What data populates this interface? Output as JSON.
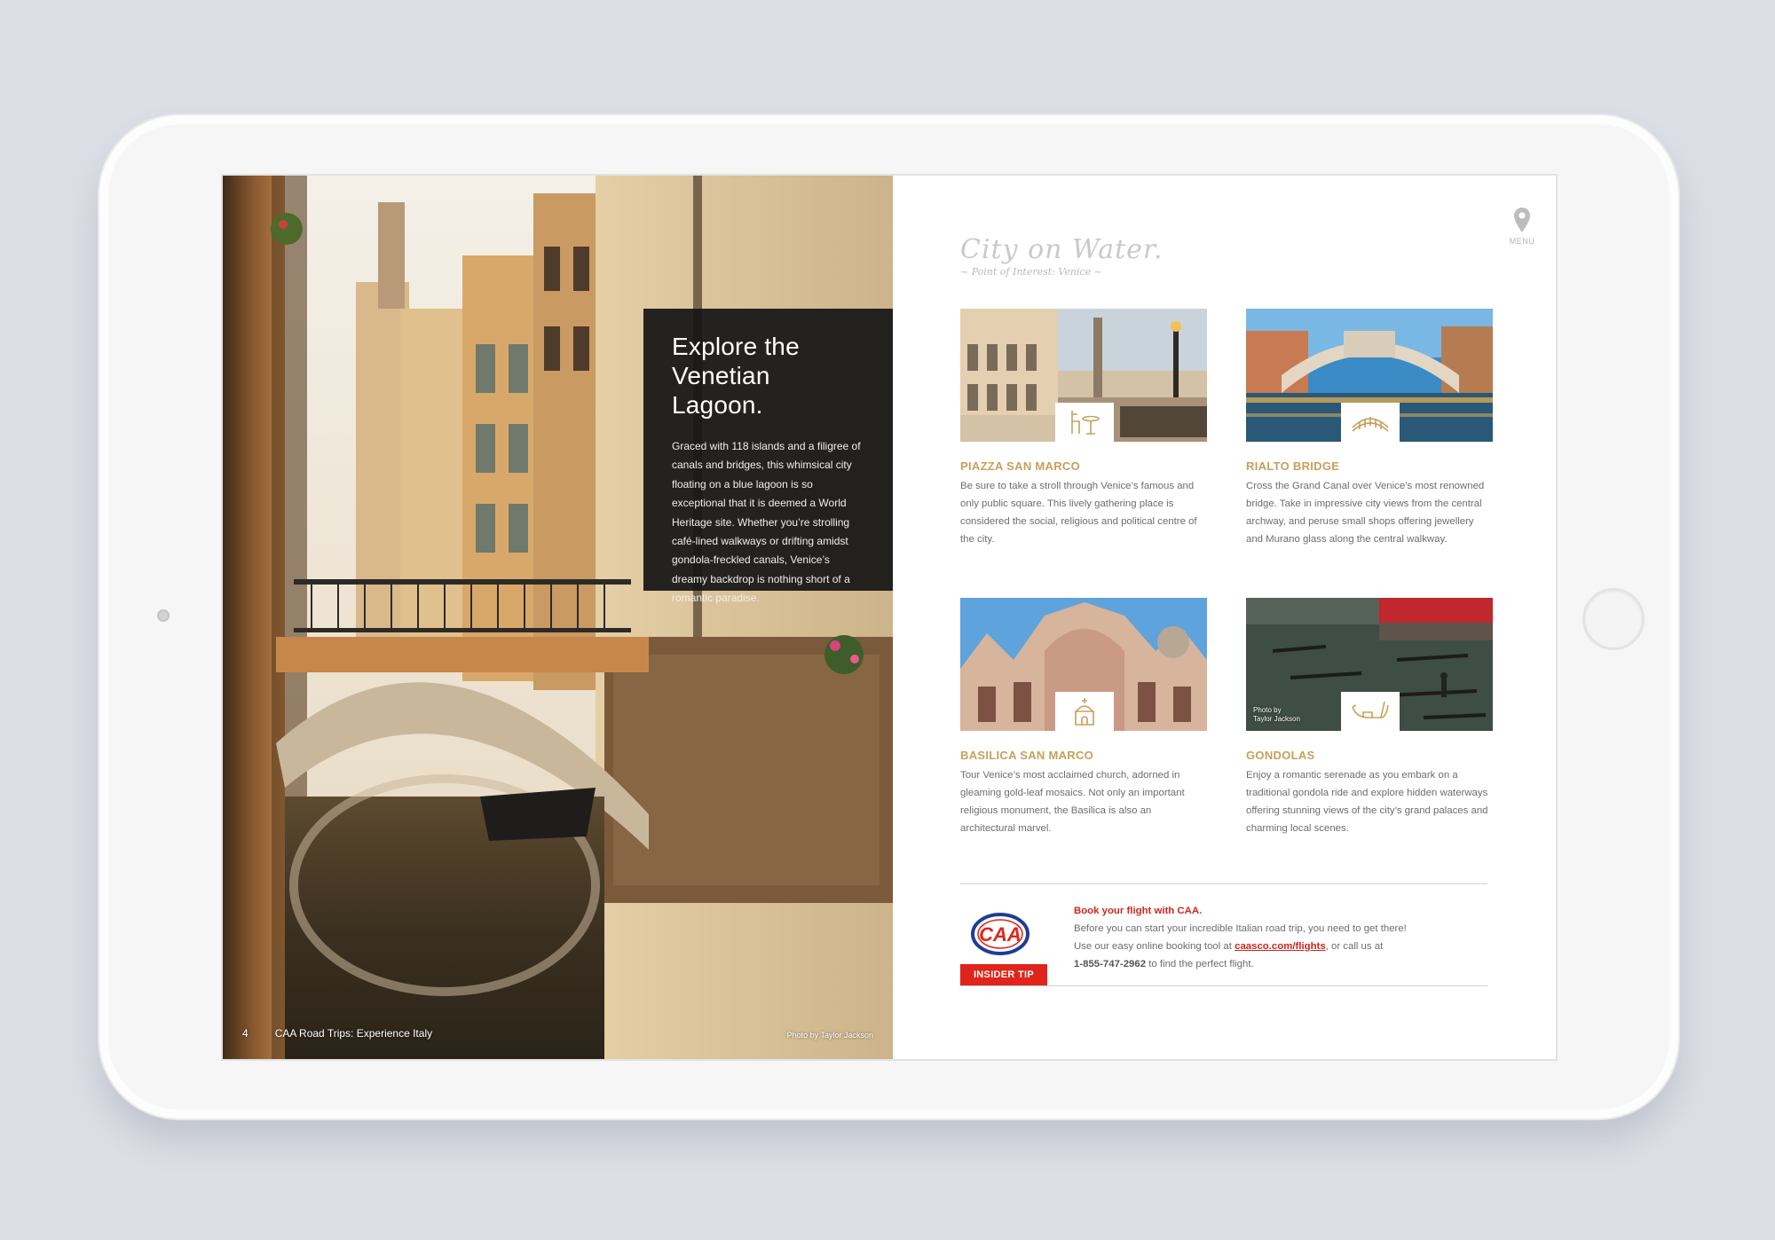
{
  "left_page": {
    "intro_title_line1": "Explore the",
    "intro_title_line2": "Venetian Lagoon.",
    "intro_body": "Graced with 118 islands and a filigree of canals and bridges, this whimsical city floating on a blue lagoon is so exceptional that it is deemed a World Heritage site. Whether you’re strolling café-lined walkways or drifting amidst gondola-freckled canals, Venice’s dreamy backdrop is nothing short of a romantic paradise.",
    "page_number": "4",
    "publication": "CAA Road Trips: Experience Italy",
    "photo_credit": "Photo by Taylor Jackson"
  },
  "right_page": {
    "title": "City on Water.",
    "subtitle": "~ Point of Interest: Venice ~",
    "menu_label": "MENU",
    "points": [
      {
        "name": "PIAZZA SAN MARCO",
        "icon": "cafe-table-icon",
        "description": "Be sure to take a stroll through Venice’s famous and only public square. This lively gathering place is considered the social, religious and political centre of the city."
      },
      {
        "name": "RIALTO BRIDGE",
        "icon": "bridge-icon",
        "description": "Cross the Grand Canal over Venice’s most renowned bridge. Take in impressive city views from the central archway, and peruse small shops offering jewellery and Murano glass along the central walkway."
      },
      {
        "name": "BASILICA SAN MARCO",
        "icon": "church-icon",
        "description": "Tour Venice’s most acclaimed church, adorned in gleaming gold-leaf mosaics. Not only an important religious monument, the Basilica is also an architectural marvel."
      },
      {
        "name": "GONDOLAS",
        "icon": "gondola-icon",
        "photo_credit_line1": "Photo by",
        "photo_credit_line2": "Taylor Jackson",
        "description": "Enjoy a romantic serenade as you embark on a traditional gondola ride and explore hidden waterways offering stunning views of the city’s grand palaces and charming local scenes."
      }
    ],
    "tip": {
      "badge": "INSIDER TIP",
      "logo_text": "CAA",
      "heading": "Book your flight with CAA.",
      "line1": "Before you can start your incredible Italian road trip, you need to get there!",
      "line2_pre": "Use our easy online booking tool at ",
      "link": "caasco.com/flights",
      "line2_post": ", or call us at",
      "phone": "1-855-747-2962",
      "line3_post": " to find the perfect flight."
    }
  },
  "colors": {
    "accent_gold": "#c7a05c",
    "caa_red": "#e0241b",
    "caa_blue": "#1c3f94"
  }
}
